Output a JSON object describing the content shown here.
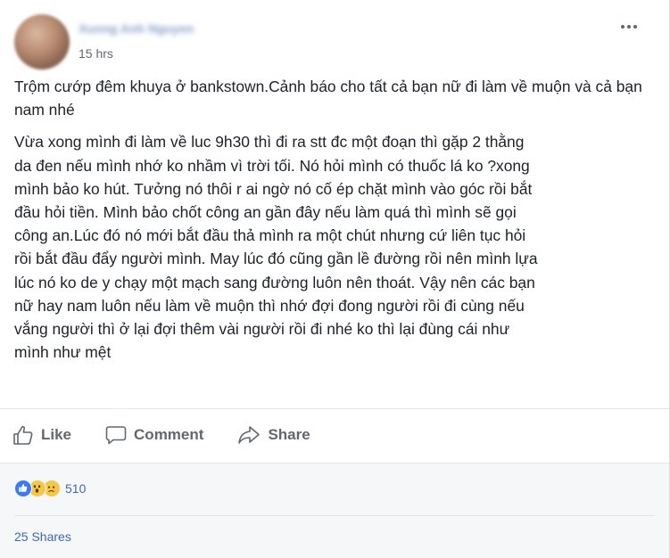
{
  "post": {
    "author_name": "Xuong Anh Nguyen",
    "timestamp": "15 hrs",
    "more_icon": "more-horizontal-icon",
    "text_intro": "Trộm cướp đêm khuya ở bankstown.Cảnh báo cho tất cả bạn nữ đi làm về muộn và cả bạn nam nhé",
    "text_body": "Vừa xong mình đi làm về luc 9h30 thì đi ra stt đc một đoạn thì gặp 2 thằng\nda đen nếu mình nhớ ko nhầm vì trời tối. Nó hỏi mình có thuốc lá ko ?xong\nmình bảo ko hút. Tưởng nó thôi r ai ngờ nó cố ép chặt mình vào góc rồi bắt\nđầu hỏi tiền. Mình bảo chốt công an gần đây nếu làm quá thì mình sẽ gọi\ncông an.Lúc đó nó mới bắt đầu thả mình ra một chút nhưng cứ liên tục hỏi\nrồi bắt đầu đẩy người mình. May lúc đó cũng gần lề đường rồi nên mình lựa\nlúc nó ko de y chạy một mạch sang đường luôn nên thoát. Vậy nên các bạn\nnữ hay nam luôn nếu làm về muộn thì nhớ đợi đong người rồi đi cùng nếu\nvắng người thì ở lại đợi thêm vài người rồi đi nhé ko thì lại đùng cái như\nmình như mệt"
  },
  "actions": {
    "like_label": "Like",
    "like_icon": "thumbs-up-icon",
    "comment_label": "Comment",
    "comment_icon": "comment-bubble-icon",
    "share_label": "Share",
    "share_icon": "share-arrow-icon"
  },
  "stats": {
    "reactions": [
      "like",
      "wow",
      "sad"
    ],
    "reaction_count": "510",
    "shares_text": "25 Shares"
  },
  "colors": {
    "text": "#1d2129",
    "muted": "#606770",
    "link": "#4267b2",
    "like_blue": "#3b7bf2",
    "emoji_yellow": "#f6c744"
  }
}
